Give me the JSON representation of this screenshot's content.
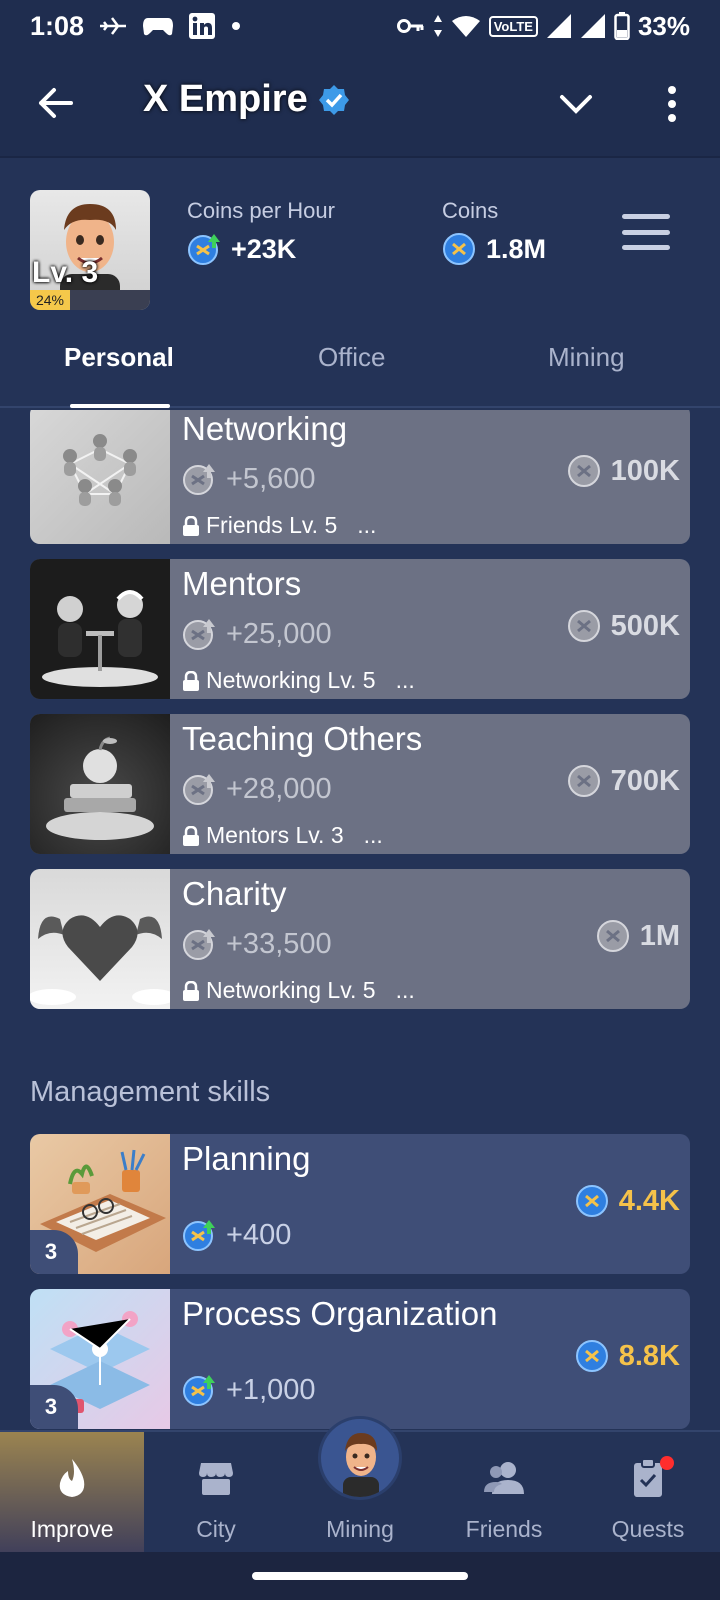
{
  "status_bar": {
    "time": "1:08",
    "battery": "33%",
    "network": "VoLTE"
  },
  "header": {
    "title": "X Empire"
  },
  "profile": {
    "level": "Lv. 3",
    "level_progress": "24%",
    "coins_per_hour_label": "Coins per Hour",
    "coins_per_hour_value": "+23K",
    "coins_label": "Coins",
    "coins_value": "1.8M"
  },
  "tabs": [
    {
      "label": "Personal",
      "active": true
    },
    {
      "label": "Office",
      "active": false
    },
    {
      "label": "Mining",
      "active": false
    }
  ],
  "personal_cards": [
    {
      "title": "Networking",
      "income": "+5,600",
      "requirement": "Friends Lv. 5",
      "ellipsis": "...",
      "price": "100K",
      "image": "networking-figures"
    },
    {
      "title": "Mentors",
      "income": "+25,000",
      "requirement": "Networking Lv. 5",
      "ellipsis": "...",
      "price": "500K",
      "image": "mentors-table"
    },
    {
      "title": "Teaching Others",
      "income": "+28,000",
      "requirement": "Mentors Lv. 3",
      "ellipsis": "...",
      "price": "700K",
      "image": "apple-books"
    },
    {
      "title": "Charity",
      "income": "+33,500",
      "requirement": "Networking Lv. 5",
      "ellipsis": "...",
      "price": "1M",
      "image": "winged-heart"
    }
  ],
  "section": {
    "title": "Management skills"
  },
  "management_cards": [
    {
      "title": "Planning",
      "income": "+400",
      "price": "4.4K",
      "level": "3",
      "image": "planning-desk"
    },
    {
      "title": "Process Organization",
      "income": "+1,000",
      "price": "8.8K",
      "level": "3",
      "image": "process-flow"
    }
  ],
  "bottom_nav": [
    {
      "label": "Improve",
      "icon": "flame-icon",
      "active": true
    },
    {
      "label": "City",
      "icon": "store-icon",
      "active": false
    },
    {
      "label": "Mining",
      "icon": "avatar",
      "active": false
    },
    {
      "label": "Friends",
      "icon": "friends-icon",
      "active": false
    },
    {
      "label": "Quests",
      "icon": "clipboard-check-icon",
      "active": false
    }
  ],
  "colors": {
    "background": "#243357",
    "header": "#1f2d4f",
    "locked_card": "#6c7184",
    "unlocked_card": "#3f4e77",
    "price_gold": "#f5c24a",
    "coin_blue": "#2f7fe0"
  }
}
